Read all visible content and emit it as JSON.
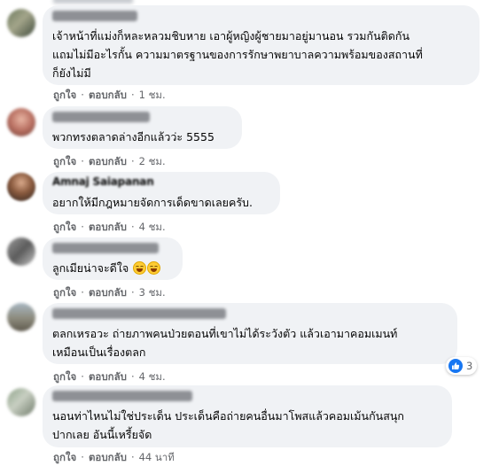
{
  "colors": {
    "bubble_bg": "#f0f2f5",
    "meta_text": "#65676b",
    "like_blue": "#1877f2",
    "text": "#050505"
  },
  "comments": [
    {
      "name": "▒▒▒▒▒▒▒▒▒▒▒▒",
      "lines": [
        "เจ้าหน้าที่แม่งก็หละหลวมชิบหาย เอาผู้หญิงผู้ชายมาอยู่มานอน รวมกันติดกัน",
        "แถมไม่มีอะไรกั้น ความมาตรฐานของการรักษาพยาบาลความพร้อมของสถานที่",
        "ก็ยังไม่มี"
      ],
      "like": "ถูกใจ",
      "reply": "ตอบกลับ",
      "time": "1 ชม."
    },
    {
      "name": "▒▒▒▒▒▒▒▒▒▒▒",
      "lines": [
        "พวกทรงตลาดล่างอีกแล้วว่ะ 5555"
      ],
      "like": "ถูกใจ",
      "reply": "ตอบกลับ",
      "time": "2 ชม."
    },
    {
      "name": "Amnaj Saiapanan",
      "lines": [
        "อยากให้มีกฎหมายจัดการเด็ดขาดเลยครับ."
      ],
      "like": "ถูกใจ",
      "reply": "ตอบกลับ",
      "time": "4 ชม."
    },
    {
      "name": "▒▒▒▒▒▒▒▒▒▒▒▒▒",
      "lines": [
        "ลูกเมียน่าจะดีใจ"
      ],
      "emoji_count": 2,
      "like": "ถูกใจ",
      "reply": "ตอบกลับ",
      "time": "3 ชม."
    },
    {
      "name": "▒▒▒▒▒▒▒▒▒▒▒▒▒▒▒▒▒▒▒",
      "lines": [
        "ตลกเหรอวะ ถ่ายภาพคนป่วยตอนที่เขาไม่ได้ระวังตัว แล้วเอามาคอมเมนท์",
        "เหมือนเป็นเรื่องตลก"
      ],
      "reaction": {
        "icon": "thumbs-up-icon",
        "count": "3"
      },
      "like": "ถูกใจ",
      "reply": "ตอบกลับ",
      "time": "4 ชม."
    },
    {
      "name": "▒▒▒▒▒▒▒▒▒▒▒▒▒▒▒▒",
      "lines": [
        "นอนท่าไหนไม่ใช่ประเด็น ประเด็นคือถ่ายคนอื่นมาโพสแล้วคอมเม้นกันสนุก",
        "ปากเลย อันนี้เหรี้ยจัด"
      ],
      "like": "ถูกใจ",
      "reply": "ตอบกลับ",
      "time": "44 นาที"
    }
  ]
}
